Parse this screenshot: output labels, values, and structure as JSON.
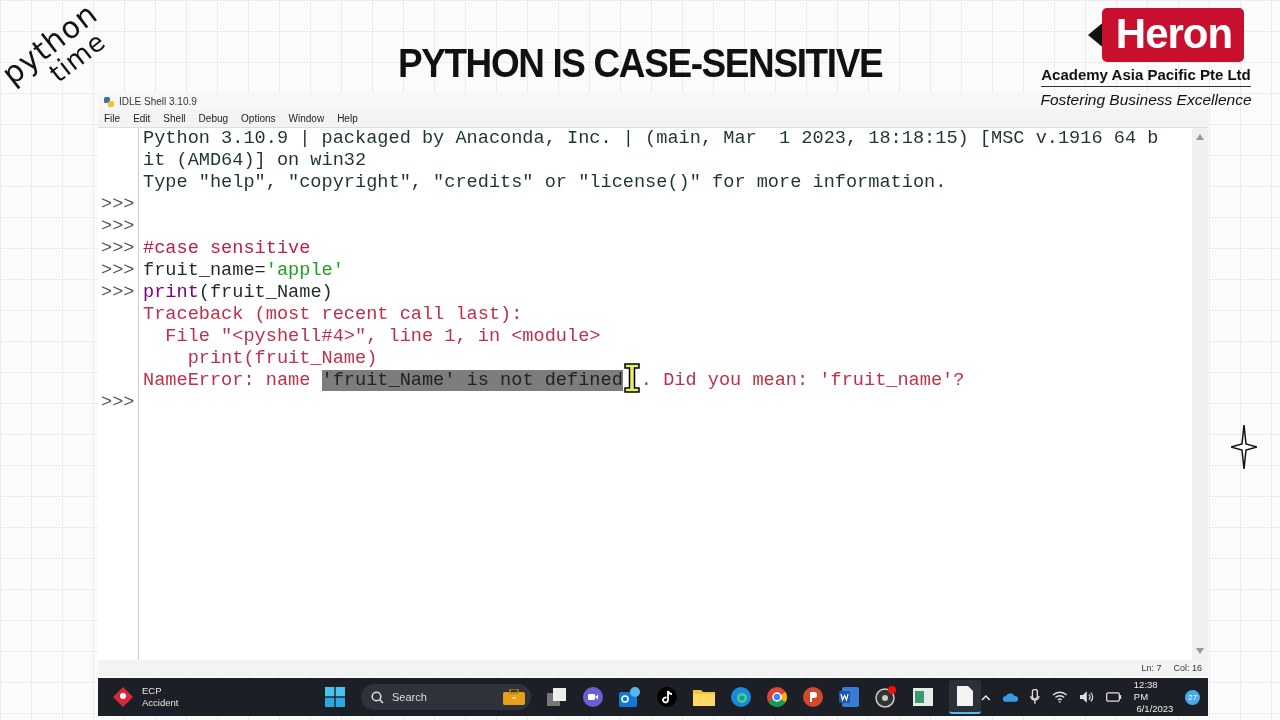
{
  "overlay": {
    "handwriting": [
      "python",
      "time"
    ],
    "title": "PYTHON IS CASE-SENSITIVE",
    "logo": {
      "brand": "Heron",
      "company": "Academy Asia Pacific Pte Ltd",
      "tagline": "Fostering Business Excellence"
    }
  },
  "window": {
    "title": "IDLE Shell 3.10.9",
    "menu": [
      "File",
      "Edit",
      "Shell",
      "Debug",
      "Options",
      "Window",
      "Help"
    ],
    "shell_lines": [
      {
        "segments": [
          {
            "kind": "output",
            "text": "Python 3.10.9 | packaged by Anaconda, Inc. | (main, Mar  1 2023, 18:18:15) [MSC v.1916 64 b"
          }
        ]
      },
      {
        "segments": [
          {
            "kind": "output",
            "text": "it (AMD64)] on win32"
          }
        ]
      },
      {
        "segments": [
          {
            "kind": "output",
            "text": "Type \"help\", \"copyright\", \"credits\" or \"license()\" for more information."
          }
        ]
      },
      {
        "prompt": ">>>"
      },
      {
        "prompt": ">>>"
      },
      {
        "prompt": ">>>",
        "segments": [
          {
            "kind": "comment",
            "text": "#case sensitive"
          }
        ]
      },
      {
        "prompt": ">>>",
        "segments": [
          {
            "kind": "code",
            "text": "fruit_name="
          },
          {
            "kind": "string",
            "text": "'apple'"
          }
        ]
      },
      {
        "prompt": ">>>",
        "segments": [
          {
            "kind": "builtin",
            "text": "print"
          },
          {
            "kind": "code",
            "text": "(fruit_Name)"
          }
        ]
      },
      {
        "segments": [
          {
            "kind": "error",
            "text": "Traceback (most recent call last):"
          }
        ]
      },
      {
        "segments": [
          {
            "kind": "error",
            "text": "  File \"<pyshell#4>\", line 1, in <module>"
          }
        ]
      },
      {
        "segments": [
          {
            "kind": "error",
            "text": "    print(fruit_Name)"
          }
        ]
      },
      {
        "segments": [
          {
            "kind": "error",
            "text": "NameError: name ",
            "selected": false
          },
          {
            "kind": "error",
            "text": "'fruit_Name' is not defined",
            "selected": true
          },
          {
            "kind": "error",
            "text": ". Did you mean: 'fruit_name'?",
            "selected": false
          }
        ]
      },
      {
        "prompt": ">>>"
      }
    ],
    "status_bar": {
      "line": "Ln: 7",
      "column": "Col: 16"
    }
  },
  "taskbar": {
    "notification": {
      "title": "ECP",
      "subtitle": "Accident"
    },
    "search": {
      "placeholder": "Search"
    },
    "clock": {
      "time": "12:38 PM",
      "date": "6/1/2023"
    },
    "badge": "27"
  }
}
